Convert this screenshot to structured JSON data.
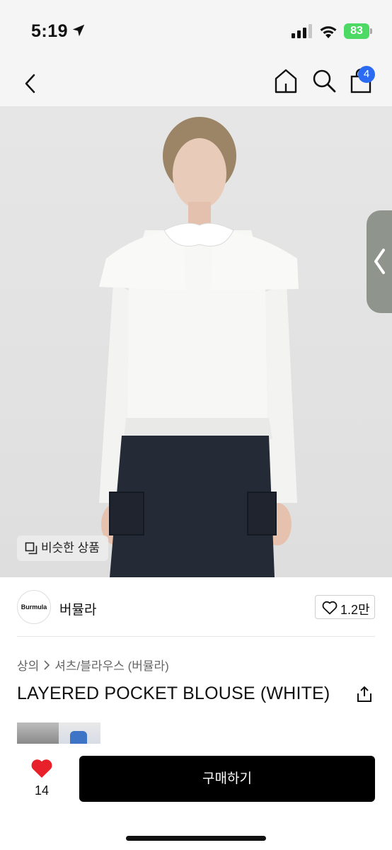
{
  "status_bar": {
    "time": "5:19",
    "battery": "83"
  },
  "nav": {
    "cart_count": "4"
  },
  "hero": {
    "similar_label": "비슷한 상품"
  },
  "seller": {
    "logo_text": "Burmula",
    "name": "버뮬라",
    "likes": "1.2만"
  },
  "breadcrumb": {
    "category": "상의",
    "subcategory": "셔츠/블라우스 (버뮬라)"
  },
  "product": {
    "title": "LAYERED POCKET BLOUSE (WHITE)"
  },
  "bottom_bar": {
    "like_count": "14",
    "buy_label": "구매하기"
  },
  "colors": {
    "accent_blue": "#2a6bf2",
    "heart_red": "#e8202a",
    "buy_bg": "#000000",
    "battery_green": "#4cd964"
  },
  "icons": [
    "location-arrow-icon",
    "signal-icon",
    "wifi-icon",
    "back-chevron-icon",
    "home-icon",
    "search-icon",
    "shopping-bag-icon",
    "chevron-left-icon",
    "copy-icon",
    "heart-outline-icon",
    "chevron-right-icon",
    "share-icon",
    "heart-filled-icon"
  ]
}
